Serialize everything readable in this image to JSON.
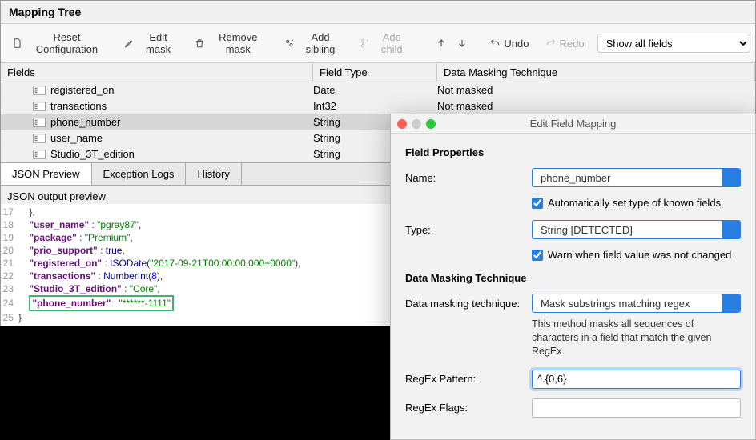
{
  "header": "Mapping Tree",
  "toolbar": {
    "reset": "Reset Configuration",
    "edit": "Edit mask",
    "remove": "Remove mask",
    "addSibling": "Add sibling",
    "addChild": "Add child",
    "undo": "Undo",
    "redo": "Redo",
    "filter": "Show all fields"
  },
  "columns": {
    "field": "Fields",
    "type": "Field Type",
    "mask": "Data Masking Technique"
  },
  "rows": [
    {
      "name": "registered_on",
      "type": "Date",
      "mask": "Not masked",
      "selected": false
    },
    {
      "name": "transactions",
      "type": "Int32",
      "mask": "Not masked",
      "selected": false
    },
    {
      "name": "phone_number",
      "type": "String",
      "mask": "Mask substrings matching regex",
      "selected": true
    },
    {
      "name": "user_name",
      "type": "String",
      "mask": "",
      "selected": false
    },
    {
      "name": "Studio_3T_edition",
      "type": "String",
      "mask": "",
      "selected": false
    }
  ],
  "tabs": {
    "preview": "JSON Preview",
    "logs": "Exception Logs",
    "history": "History",
    "active": "preview"
  },
  "previewLabel": "JSON output preview",
  "json": {
    "startLine": 17,
    "user_name": "pgray87",
    "package": "Premium",
    "prio_support": "true",
    "registered_on_fn": "ISODate",
    "registered_on_arg": "2017-09-21T00:00:00.000+0000",
    "transactions_fn": "NumberInt",
    "transactions_arg": "8",
    "studio_edition": "Core",
    "phone_number": "******-1111"
  },
  "dialog": {
    "title": "Edit Field Mapping",
    "section1": "Field Properties",
    "nameLabel": "Name:",
    "nameValue": "phone_number",
    "autoType": "Automatically set type of known fields",
    "typeLabel": "Type:",
    "typeValue": "String [DETECTED]",
    "warn": "Warn when field value was not changed",
    "section2": "Data Masking Technique",
    "dmtLabel": "Data masking technique:",
    "dmtValue": "Mask substrings matching regex",
    "dmtDesc": "This method masks all sequences of characters in a field that match the given RegEx.",
    "regexLabel": "RegEx Pattern:",
    "regexValue": "^.{0,6}",
    "flagsLabel": "RegEx Flags:",
    "flagsValue": ""
  }
}
